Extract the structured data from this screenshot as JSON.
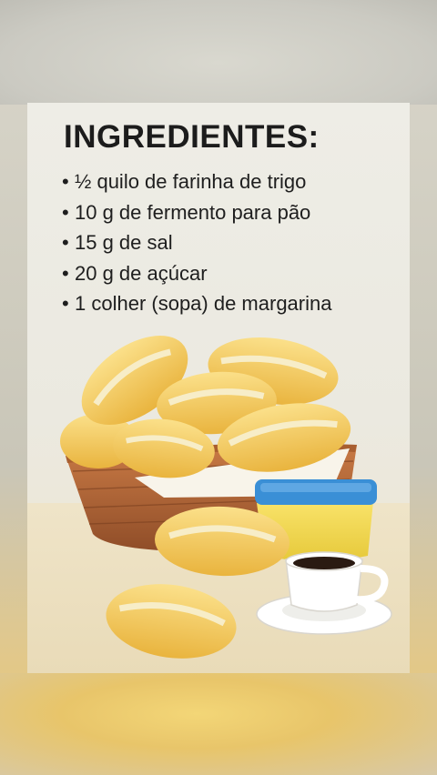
{
  "card": {
    "title": "INGREDIENTES:",
    "ingredients": [
      "½ quilo de farinha de trigo",
      "10 g de fermento para pão",
      "15 g de sal",
      "20 g de açúcar",
      "1 colher (sopa) de margarina"
    ],
    "bullet": "•"
  },
  "colors": {
    "bread": "#f5c95a",
    "basket": "#b8683a",
    "tub_lid": "#3a8fd6",
    "tub_body": "#f7df4e",
    "coffee": "#2a1a12"
  },
  "illustration_items": [
    "bread-basket",
    "bread-roll",
    "margarine-tub",
    "coffee-cup"
  ]
}
